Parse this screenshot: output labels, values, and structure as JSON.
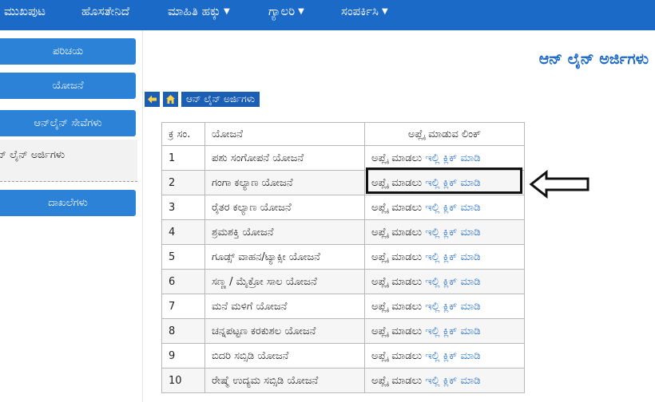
{
  "nav": {
    "items": [
      {
        "label": "ಮುಖಪುಟ",
        "dropdown": false
      },
      {
        "label": "ಹೊಸತೇನಿದೆ",
        "dropdown": false
      },
      {
        "label": "ಮಾಹಿತಿ ಹಕ್ಕು",
        "dropdown": true
      },
      {
        "label": "ಗ್ಯಾಲರಿ",
        "dropdown": true
      },
      {
        "label": "ಸಂಪರ್ಕಿಸಿ",
        "dropdown": true
      }
    ],
    "caret": "▼"
  },
  "sidebar": {
    "items": [
      {
        "label": "ಪರಿಚಯ"
      },
      {
        "label": "ಯೋಜನೆ"
      },
      {
        "label": "ಆನ್‌ಲೈನ್ ಸೇವೆಗಳು"
      },
      {
        "label": "ದಾಖಲೆಗಳು"
      }
    ],
    "sub_item": "ಆನ್ ಲೈನ್ ಅರ್ಜಿಗಳು"
  },
  "page_title": "ಆನ್ ಲೈನ್ ಅರ್ಜಿಗಳು",
  "breadcrumb": {
    "back_icon": "arrow-left-icon",
    "home_icon": "home-icon",
    "current": "ಆನ್ ಲೈನ್ ಅರ್ಜಿಗಳು"
  },
  "table": {
    "headers": [
      "ಕ್ರ ಸಂ.",
      "ಯೋಜನೆ",
      "ಅಪ್ಲೈ ಮಾಡುವ ಲಿಂಕ್"
    ],
    "apply_text": "ಅಪ್ಲೈ ಮಾಡಲು",
    "link_text": "ಇಲ್ಲಿ ಕ್ಲಿಕ್ ಮಾಡಿ",
    "rows": [
      {
        "num": "1",
        "scheme": "ಪಶು ಸಂಗೋಪನೆ ಯೋಜನೆ"
      },
      {
        "num": "2",
        "scheme": "ಗಂಗಾ ಕಲ್ಯಾಣ ಯೋಜನೆ"
      },
      {
        "num": "3",
        "scheme": "ರೈತರ ಕಲ್ಯಾಣ ಯೋಜನೆ"
      },
      {
        "num": "4",
        "scheme": "ಶ್ರಮಶಕ್ತಿ ಯೋಜನೆ"
      },
      {
        "num": "5",
        "scheme": "ಗೂಡ್ಸ್ ವಾಹನ/ಟ್ಯಾಕ್ಸೀ ಯೋಜನೆ"
      },
      {
        "num": "6",
        "scheme": "ಸಣ್ಣ / ಮೈಕ್ರೋ ಸಾಲ ಯೋಜನೆ"
      },
      {
        "num": "7",
        "scheme": "ಮನೆ ಮಳಿಗೆ ಯೋಜನೆ"
      },
      {
        "num": "8",
        "scheme": "ಚನ್ನಪಟ್ಟಣ ಕರಕುಶಲ ಯೋಜನೆ"
      },
      {
        "num": "9",
        "scheme": "ಬಿದರಿ ಸಬ್ಸಿಡಿ ಯೋಜನೆ"
      },
      {
        "num": "10",
        "scheme": "ರೇಷ್ಮೆ ಉದ್ಯಮ ಸಬ್ಸಿಡಿ ಯೋಜನೆ"
      }
    ]
  },
  "colors": {
    "nav_bg": "#1c6ac8",
    "sidebar_button": "#2b82d6",
    "link": "#1c6ac8",
    "breadcrumb_bg": "#1a5fb4",
    "breadcrumb_icon": "#ffd24a"
  }
}
